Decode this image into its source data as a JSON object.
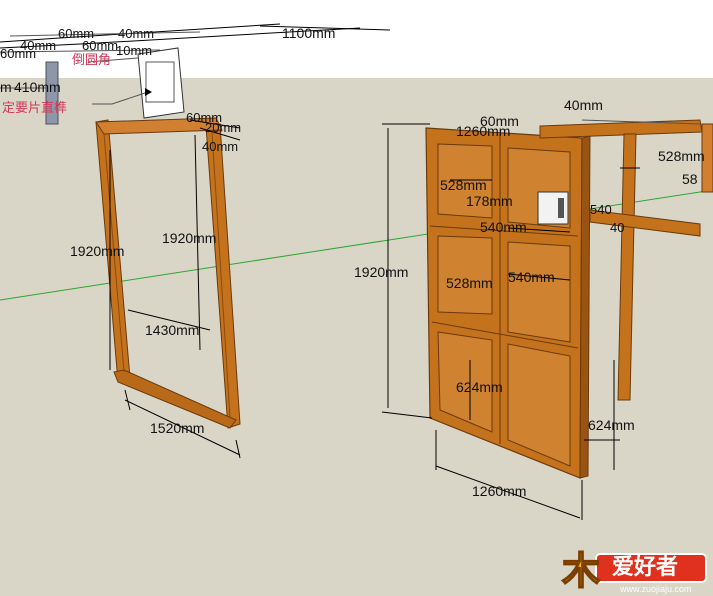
{
  "colors": {
    "sky": "#ffffff",
    "ground": "#d9d6c8",
    "wood": "#c4731c",
    "wood_dark": "#8a4a10",
    "dimension_line": "#000000",
    "axis_green": "#2fa52f",
    "note_text": "#d23a5a",
    "watermark_orange": "#f4b400",
    "watermark_red": "#e0301e"
  },
  "frame_dims": {
    "height_left": "1920mm",
    "height_inner": "1920mm",
    "inner_width": "1430mm",
    "outer_width": "1520mm",
    "rail_a": "60mm",
    "rail_b": "20mm",
    "rail_c": "40mm"
  },
  "top_dims": {
    "a": "60mm",
    "b": "40mm",
    "c": "40mm",
    "d": "60mm",
    "e": "60mm",
    "f": "10mm",
    "g": "1100mm",
    "h": "410mm",
    "i": "m"
  },
  "notes": {
    "rounded_corner": "倒圆角",
    "tenon": "定要片直榫"
  },
  "door_dims": {
    "height": "1920mm",
    "width": "1260mm",
    "top_width": "1260mm",
    "top_rail": "60mm",
    "stile_top": "40mm",
    "panel_upper": "528mm",
    "panel_mid": "528mm",
    "rail_178": "178mm",
    "panel_width_left": "540mm",
    "panel_width_right": "540mm",
    "panel_lower": "624mm",
    "panel_lower_right": "624mm",
    "side_40": "40mm",
    "far_528": "528mm",
    "far_58": "58",
    "side_540": "540",
    "side_40b": "40"
  },
  "watermark": {
    "logo_char": "木",
    "brand": "爱好者",
    "url": "www.zuojiaju.com"
  }
}
